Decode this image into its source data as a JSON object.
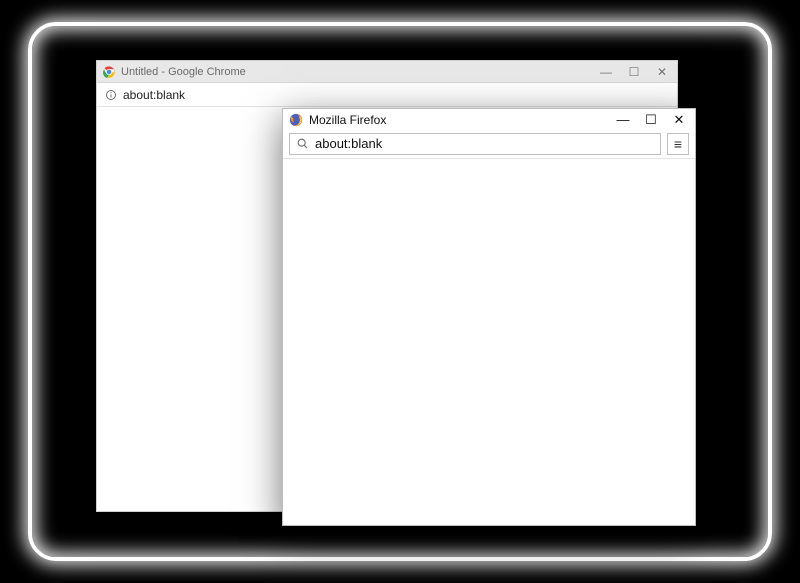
{
  "chrome": {
    "title": "Untitled - Google Chrome",
    "url": "about:blank"
  },
  "firefox": {
    "title": "Mozilla Firefox",
    "url": "about:blank"
  },
  "glyph": {
    "minimize": "—",
    "maximize": "☐",
    "close": "✕",
    "min_thin": "—",
    "menu": "≡"
  }
}
